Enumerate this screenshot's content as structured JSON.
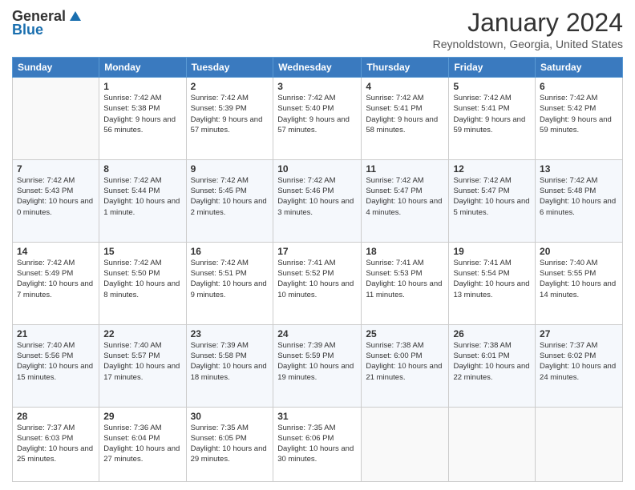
{
  "header": {
    "logo_general": "General",
    "logo_blue": "Blue",
    "month": "January 2024",
    "location": "Reynoldstown, Georgia, United States"
  },
  "columns": [
    "Sunday",
    "Monday",
    "Tuesday",
    "Wednesday",
    "Thursday",
    "Friday",
    "Saturday"
  ],
  "weeks": [
    [
      {
        "day": "",
        "sunrise": "",
        "sunset": "",
        "daylight": ""
      },
      {
        "day": "1",
        "sunrise": "Sunrise: 7:42 AM",
        "sunset": "Sunset: 5:38 PM",
        "daylight": "Daylight: 9 hours and 56 minutes."
      },
      {
        "day": "2",
        "sunrise": "Sunrise: 7:42 AM",
        "sunset": "Sunset: 5:39 PM",
        "daylight": "Daylight: 9 hours and 57 minutes."
      },
      {
        "day": "3",
        "sunrise": "Sunrise: 7:42 AM",
        "sunset": "Sunset: 5:40 PM",
        "daylight": "Daylight: 9 hours and 57 minutes."
      },
      {
        "day": "4",
        "sunrise": "Sunrise: 7:42 AM",
        "sunset": "Sunset: 5:41 PM",
        "daylight": "Daylight: 9 hours and 58 minutes."
      },
      {
        "day": "5",
        "sunrise": "Sunrise: 7:42 AM",
        "sunset": "Sunset: 5:41 PM",
        "daylight": "Daylight: 9 hours and 59 minutes."
      },
      {
        "day": "6",
        "sunrise": "Sunrise: 7:42 AM",
        "sunset": "Sunset: 5:42 PM",
        "daylight": "Daylight: 9 hours and 59 minutes."
      }
    ],
    [
      {
        "day": "7",
        "sunrise": "Sunrise: 7:42 AM",
        "sunset": "Sunset: 5:43 PM",
        "daylight": "Daylight: 10 hours and 0 minutes."
      },
      {
        "day": "8",
        "sunrise": "Sunrise: 7:42 AM",
        "sunset": "Sunset: 5:44 PM",
        "daylight": "Daylight: 10 hours and 1 minute."
      },
      {
        "day": "9",
        "sunrise": "Sunrise: 7:42 AM",
        "sunset": "Sunset: 5:45 PM",
        "daylight": "Daylight: 10 hours and 2 minutes."
      },
      {
        "day": "10",
        "sunrise": "Sunrise: 7:42 AM",
        "sunset": "Sunset: 5:46 PM",
        "daylight": "Daylight: 10 hours and 3 minutes."
      },
      {
        "day": "11",
        "sunrise": "Sunrise: 7:42 AM",
        "sunset": "Sunset: 5:47 PM",
        "daylight": "Daylight: 10 hours and 4 minutes."
      },
      {
        "day": "12",
        "sunrise": "Sunrise: 7:42 AM",
        "sunset": "Sunset: 5:47 PM",
        "daylight": "Daylight: 10 hours and 5 minutes."
      },
      {
        "day": "13",
        "sunrise": "Sunrise: 7:42 AM",
        "sunset": "Sunset: 5:48 PM",
        "daylight": "Daylight: 10 hours and 6 minutes."
      }
    ],
    [
      {
        "day": "14",
        "sunrise": "Sunrise: 7:42 AM",
        "sunset": "Sunset: 5:49 PM",
        "daylight": "Daylight: 10 hours and 7 minutes."
      },
      {
        "day": "15",
        "sunrise": "Sunrise: 7:42 AM",
        "sunset": "Sunset: 5:50 PM",
        "daylight": "Daylight: 10 hours and 8 minutes."
      },
      {
        "day": "16",
        "sunrise": "Sunrise: 7:42 AM",
        "sunset": "Sunset: 5:51 PM",
        "daylight": "Daylight: 10 hours and 9 minutes."
      },
      {
        "day": "17",
        "sunrise": "Sunrise: 7:41 AM",
        "sunset": "Sunset: 5:52 PM",
        "daylight": "Daylight: 10 hours and 10 minutes."
      },
      {
        "day": "18",
        "sunrise": "Sunrise: 7:41 AM",
        "sunset": "Sunset: 5:53 PM",
        "daylight": "Daylight: 10 hours and 11 minutes."
      },
      {
        "day": "19",
        "sunrise": "Sunrise: 7:41 AM",
        "sunset": "Sunset: 5:54 PM",
        "daylight": "Daylight: 10 hours and 13 minutes."
      },
      {
        "day": "20",
        "sunrise": "Sunrise: 7:40 AM",
        "sunset": "Sunset: 5:55 PM",
        "daylight": "Daylight: 10 hours and 14 minutes."
      }
    ],
    [
      {
        "day": "21",
        "sunrise": "Sunrise: 7:40 AM",
        "sunset": "Sunset: 5:56 PM",
        "daylight": "Daylight: 10 hours and 15 minutes."
      },
      {
        "day": "22",
        "sunrise": "Sunrise: 7:40 AM",
        "sunset": "Sunset: 5:57 PM",
        "daylight": "Daylight: 10 hours and 17 minutes."
      },
      {
        "day": "23",
        "sunrise": "Sunrise: 7:39 AM",
        "sunset": "Sunset: 5:58 PM",
        "daylight": "Daylight: 10 hours and 18 minutes."
      },
      {
        "day": "24",
        "sunrise": "Sunrise: 7:39 AM",
        "sunset": "Sunset: 5:59 PM",
        "daylight": "Daylight: 10 hours and 19 minutes."
      },
      {
        "day": "25",
        "sunrise": "Sunrise: 7:38 AM",
        "sunset": "Sunset: 6:00 PM",
        "daylight": "Daylight: 10 hours and 21 minutes."
      },
      {
        "day": "26",
        "sunrise": "Sunrise: 7:38 AM",
        "sunset": "Sunset: 6:01 PM",
        "daylight": "Daylight: 10 hours and 22 minutes."
      },
      {
        "day": "27",
        "sunrise": "Sunrise: 7:37 AM",
        "sunset": "Sunset: 6:02 PM",
        "daylight": "Daylight: 10 hours and 24 minutes."
      }
    ],
    [
      {
        "day": "28",
        "sunrise": "Sunrise: 7:37 AM",
        "sunset": "Sunset: 6:03 PM",
        "daylight": "Daylight: 10 hours and 25 minutes."
      },
      {
        "day": "29",
        "sunrise": "Sunrise: 7:36 AM",
        "sunset": "Sunset: 6:04 PM",
        "daylight": "Daylight: 10 hours and 27 minutes."
      },
      {
        "day": "30",
        "sunrise": "Sunrise: 7:35 AM",
        "sunset": "Sunset: 6:05 PM",
        "daylight": "Daylight: 10 hours and 29 minutes."
      },
      {
        "day": "31",
        "sunrise": "Sunrise: 7:35 AM",
        "sunset": "Sunset: 6:06 PM",
        "daylight": "Daylight: 10 hours and 30 minutes."
      },
      {
        "day": "",
        "sunrise": "",
        "sunset": "",
        "daylight": ""
      },
      {
        "day": "",
        "sunrise": "",
        "sunset": "",
        "daylight": ""
      },
      {
        "day": "",
        "sunrise": "",
        "sunset": "",
        "daylight": ""
      }
    ]
  ]
}
